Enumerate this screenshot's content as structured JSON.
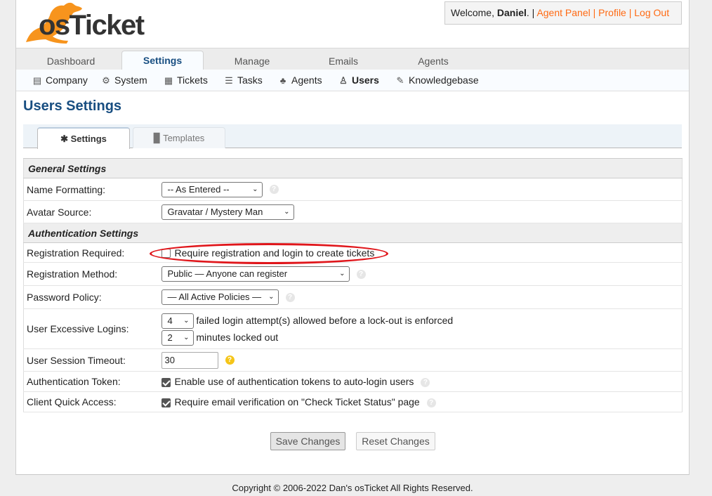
{
  "brand": {
    "logo_text": "osTicket",
    "logo_color": "#f7941d"
  },
  "header": {
    "welcome_prefix": "Welcome, ",
    "user_name": "Daniel",
    "suffix": ". | ",
    "agent_panel": "Agent Panel",
    "profile": "Profile",
    "logout": "Log Out",
    "sep": " | "
  },
  "nav": {
    "tabs": [
      "Dashboard",
      "Settings",
      "Manage",
      "Emails",
      "Agents"
    ],
    "active": "Settings"
  },
  "subnav": {
    "items": [
      {
        "label": "Company",
        "icon": "company-icon"
      },
      {
        "label": "System",
        "icon": "gear-icon"
      },
      {
        "label": "Tickets",
        "icon": "ticket-icon"
      },
      {
        "label": "Tasks",
        "icon": "tasks-icon"
      },
      {
        "label": "Agents",
        "icon": "agents-icon"
      },
      {
        "label": "Users",
        "icon": "users-icon"
      },
      {
        "label": "Knowledgebase",
        "icon": "knowledgebase-icon"
      }
    ],
    "active": "Users"
  },
  "page": {
    "title": "Users Settings"
  },
  "settings_tabs": {
    "settings": "Settings",
    "templates": "Templates"
  },
  "general": {
    "heading": "General Settings",
    "name_formatting": {
      "label": "Name Formatting:",
      "value": "-- As Entered --"
    },
    "avatar_source": {
      "label": "Avatar Source:",
      "value": "Gravatar / Mystery Man"
    }
  },
  "auth": {
    "heading": "Authentication Settings",
    "registration_required": {
      "label": "Registration Required:",
      "text": "Require registration and login to create tickets",
      "checked": false
    },
    "registration_method": {
      "label": "Registration Method:",
      "value": "Public — Anyone can register"
    },
    "password_policy": {
      "label": "Password Policy:",
      "value": "— All Active Policies —"
    },
    "excessive_logins": {
      "label": "User Excessive Logins:",
      "attempts_value": "4",
      "attempts_text": "failed login attempt(s) allowed before a lock-out is enforced",
      "lockout_value": "2",
      "lockout_text": "minutes locked out"
    },
    "session_timeout": {
      "label": "User Session Timeout:",
      "value": "30"
    },
    "auth_token": {
      "label": "Authentication Token:",
      "text": "Enable use of authentication tokens to auto-login users",
      "checked": true
    },
    "quick_access": {
      "label": "Client Quick Access:",
      "text": "Require email verification on \"Check Ticket Status\" page",
      "checked": true
    }
  },
  "buttons": {
    "save": "Save Changes",
    "reset": "Reset Changes"
  },
  "footer": {
    "copyright": "Copyright © 2006-2022 Dan's osTicket All Rights Reserved."
  },
  "colors": {
    "link": "#ff6a13",
    "title": "#184e81",
    "annotation": "#e0161b"
  }
}
